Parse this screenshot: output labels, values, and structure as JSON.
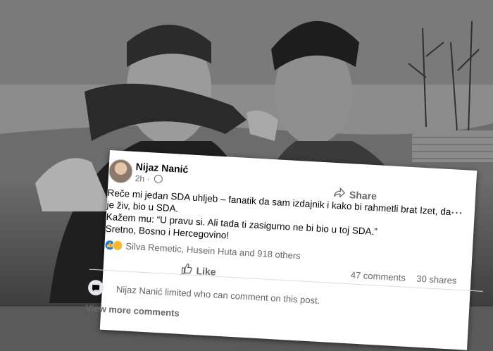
{
  "post": {
    "author": "Nijaz Nanić",
    "time": "2h · ",
    "lines": [
      "Reče mi jedan SDA uhljeb – fanatik da sam izdajnik i kako bi rahmetli brat Izet, da je živ, bio u SDA.",
      "Kažem mu: “U pravu si. Ali tada ti zasigurno ne bi bio u toj SDA.”",
      "Sretno, Bosno i Hercegovino!"
    ],
    "more_label": "···",
    "reactions": {
      "icons": [
        "like-icon",
        "care-icon"
      ],
      "text": "Silva Remetic, Husein Huta and 918 others"
    },
    "comments_count": "47 comments",
    "shares_count": "30 shares",
    "like_label": "Like",
    "share_label": "Share",
    "notice": "Nijaz Nanić limited who can comment on this post.",
    "view_more": "View more comments"
  }
}
